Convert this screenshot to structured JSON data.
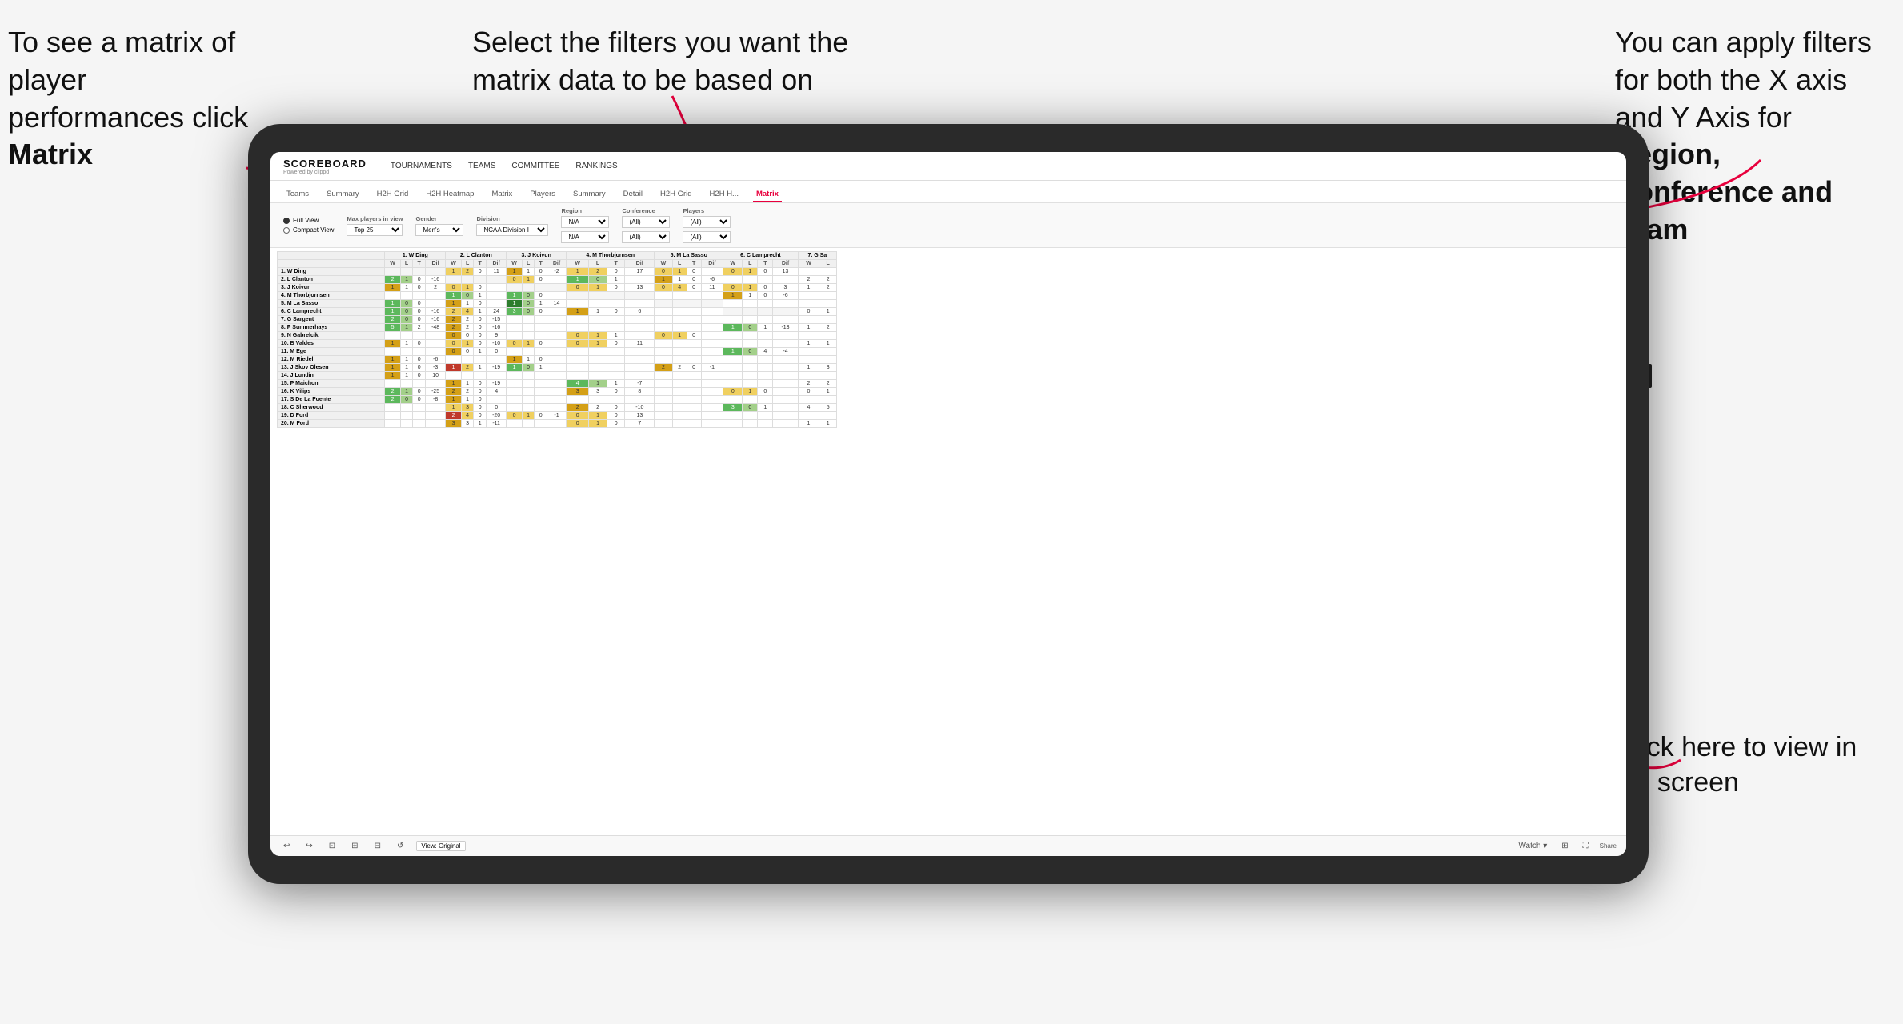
{
  "annotations": {
    "top_left": "To see a matrix of player performances click Matrix",
    "top_left_bold": "Matrix",
    "top_center": "Select the filters you want the matrix data to be based on",
    "top_right_prefix": "You  can apply filters for both the X axis and Y Axis for ",
    "top_right_bold": "Region, Conference and Team",
    "bottom_right": "Click here to view in full screen"
  },
  "scoreboard": {
    "logo": "SCOREBOARD",
    "logo_sub": "Powered by clippd",
    "nav": [
      "TOURNAMENTS",
      "TEAMS",
      "COMMITTEE",
      "RANKINGS"
    ]
  },
  "sub_nav": [
    "Teams",
    "Summary",
    "H2H Grid",
    "H2H Heatmap",
    "Matrix",
    "Players",
    "Summary",
    "Detail",
    "H2H Grid",
    "H2H H...",
    "Matrix"
  ],
  "filters": {
    "views": [
      "Full View",
      "Compact View"
    ],
    "max_players": "Top 25",
    "gender": "Men's",
    "division": "NCAA Division I",
    "region_label": "Region",
    "region_val": "N/A",
    "conference_label": "Conference",
    "conference_val": "(All)",
    "players_label": "Players",
    "players_val": "(All)"
  },
  "matrix": {
    "col_headers": [
      "1. W Ding",
      "2. L Clanton",
      "3. J Koivun",
      "4. M Thorbjornsen",
      "5. M La Sasso",
      "6. C Lamprecht",
      "7. G Sa"
    ],
    "sub_cols": [
      "W",
      "L",
      "T",
      "Dif"
    ],
    "rows": [
      {
        "name": "1. W Ding",
        "cells": [
          [
            null,
            null,
            null,
            null
          ],
          [
            1,
            2,
            0,
            11
          ],
          [
            1,
            1,
            0,
            -2
          ],
          [
            1,
            2,
            0,
            17
          ],
          [
            0,
            1,
            0,
            null
          ],
          [
            0,
            1,
            0,
            13
          ],
          [
            null,
            null
          ]
        ]
      },
      {
        "name": "2. L Clanton",
        "cells": [
          [
            2,
            1,
            0,
            -16
          ],
          [
            null,
            null,
            null,
            null
          ],
          [
            0,
            1,
            0,
            null
          ],
          [
            1,
            0,
            1,
            null
          ],
          [
            1,
            1,
            0,
            -6
          ],
          [
            null,
            null,
            null,
            null
          ],
          [
            2,
            2
          ]
        ]
      },
      {
        "name": "3. J Koivun",
        "cells": [
          [
            1,
            1,
            0,
            2
          ],
          [
            0,
            1,
            0,
            null
          ],
          [
            null,
            null,
            null,
            null
          ],
          [
            0,
            1,
            0,
            13
          ],
          [
            0,
            4,
            0,
            11
          ],
          [
            0,
            1,
            0,
            3
          ],
          [
            1,
            2
          ]
        ]
      },
      {
        "name": "4. M Thorbjornsen",
        "cells": [
          [
            null,
            null,
            null,
            null
          ],
          [
            1,
            0,
            1,
            null
          ],
          [
            1,
            0,
            0,
            null
          ],
          [
            null,
            null,
            null,
            null
          ],
          [
            null,
            null,
            null,
            null
          ],
          [
            1,
            1,
            0,
            -6
          ],
          [
            null,
            null
          ]
        ]
      },
      {
        "name": "5. M La Sasso",
        "cells": [
          [
            1,
            0,
            0,
            null
          ],
          [
            1,
            1,
            0,
            null
          ],
          [
            1,
            0,
            1,
            14
          ],
          [
            null,
            null,
            null,
            null
          ],
          [
            null,
            null,
            null,
            null
          ],
          [
            null,
            null,
            null,
            null
          ],
          [
            null,
            null
          ]
        ]
      },
      {
        "name": "6. C Lamprecht",
        "cells": [
          [
            1,
            0,
            0,
            -16
          ],
          [
            2,
            4,
            1,
            24
          ],
          [
            3,
            0,
            0,
            null
          ],
          [
            1,
            1,
            0,
            6
          ],
          [
            null,
            null,
            null,
            null
          ],
          [
            null,
            null,
            null,
            null
          ],
          [
            0,
            1
          ]
        ]
      },
      {
        "name": "7. G Sargent",
        "cells": [
          [
            2,
            0,
            0,
            -16
          ],
          [
            2,
            2,
            0,
            -15
          ],
          [
            null,
            null,
            null,
            null
          ],
          [
            null,
            null,
            null,
            null
          ],
          [
            null,
            null,
            null,
            null
          ],
          [
            null,
            null,
            null,
            null
          ],
          [
            null,
            null
          ]
        ]
      },
      {
        "name": "8. P Summerhays",
        "cells": [
          [
            5,
            1,
            2,
            -48
          ],
          [
            2,
            2,
            0,
            -16
          ],
          [
            null,
            null,
            null,
            null
          ],
          [
            null,
            null,
            null,
            null
          ],
          [
            null,
            null,
            null,
            null
          ],
          [
            1,
            0,
            1,
            -13
          ],
          [
            1,
            2
          ]
        ]
      },
      {
        "name": "9. N Gabrelcik",
        "cells": [
          [
            null,
            null,
            null,
            null
          ],
          [
            0,
            0,
            0,
            9
          ],
          [
            null,
            null,
            null,
            null
          ],
          [
            0,
            1,
            1,
            null
          ],
          [
            0,
            1,
            0,
            null
          ],
          [
            null,
            null,
            null,
            null
          ],
          [
            null,
            null
          ]
        ]
      },
      {
        "name": "10. B Valdes",
        "cells": [
          [
            1,
            1,
            0,
            null
          ],
          [
            0,
            1,
            0,
            -10
          ],
          [
            0,
            1,
            0,
            null
          ],
          [
            0,
            1,
            0,
            11
          ],
          [
            null,
            null,
            null,
            null
          ],
          [
            null,
            null,
            null,
            null
          ],
          [
            1,
            1
          ]
        ]
      },
      {
        "name": "11. M Ege",
        "cells": [
          [
            null,
            null,
            null,
            null
          ],
          [
            0,
            0,
            1,
            0
          ],
          [
            null,
            null,
            null,
            null
          ],
          [
            null,
            null,
            null,
            null
          ],
          [
            null,
            null,
            null,
            null
          ],
          [
            1,
            0,
            4,
            -4
          ],
          [
            null,
            null
          ]
        ]
      },
      {
        "name": "12. M Riedel",
        "cells": [
          [
            1,
            1,
            0,
            -6
          ],
          [
            null,
            null,
            null,
            null
          ],
          [
            1,
            1,
            0,
            null
          ],
          [
            null,
            null,
            null,
            null
          ],
          [
            null,
            null,
            null,
            null
          ],
          [
            null,
            null,
            null,
            null
          ],
          [
            null,
            null
          ]
        ]
      },
      {
        "name": "13. J Skov Olesen",
        "cells": [
          [
            1,
            1,
            0,
            -3
          ],
          [
            1,
            2,
            1,
            -19
          ],
          [
            1,
            0,
            1,
            null
          ],
          [
            null,
            null,
            null,
            null
          ],
          [
            2,
            2,
            0,
            -1
          ],
          [
            null,
            null,
            null,
            null
          ],
          [
            1,
            3
          ]
        ]
      },
      {
        "name": "14. J Lundin",
        "cells": [
          [
            1,
            1,
            0,
            10
          ],
          [
            null,
            null,
            null,
            null
          ],
          [
            null,
            null,
            null,
            null
          ],
          [
            null,
            null,
            null,
            null
          ],
          [
            null,
            null,
            null,
            null
          ],
          [
            null,
            null,
            null,
            null
          ],
          [
            null,
            null
          ]
        ]
      },
      {
        "name": "15. P Maichon",
        "cells": [
          [
            null,
            null,
            null,
            null
          ],
          [
            1,
            1,
            0,
            -19
          ],
          [
            null,
            null,
            null,
            null
          ],
          [
            4,
            1,
            1,
            -7
          ],
          [
            null,
            null,
            null,
            null
          ],
          [
            null,
            null,
            null,
            null
          ],
          [
            2,
            2
          ]
        ]
      },
      {
        "name": "16. K Vilips",
        "cells": [
          [
            2,
            1,
            0,
            -25
          ],
          [
            2,
            2,
            0,
            4
          ],
          [
            null,
            null,
            null,
            null
          ],
          [
            3,
            3,
            0,
            8
          ],
          [
            null,
            null,
            null,
            null
          ],
          [
            0,
            1,
            0,
            null
          ],
          [
            0,
            1
          ]
        ]
      },
      {
        "name": "17. S De La Fuente",
        "cells": [
          [
            2,
            0,
            0,
            -8
          ],
          [
            1,
            1,
            0,
            null
          ],
          [
            null,
            null,
            null,
            null
          ],
          [
            null,
            null,
            null,
            null
          ],
          [
            null,
            null,
            null,
            null
          ],
          [
            null,
            null,
            null,
            null
          ],
          [
            null,
            null
          ]
        ]
      },
      {
        "name": "18. C Sherwood",
        "cells": [
          [
            null,
            null,
            null,
            null
          ],
          [
            1,
            3,
            0,
            0
          ],
          [
            null,
            null,
            null,
            null
          ],
          [
            2,
            2,
            0,
            -10
          ],
          [
            null,
            null,
            null,
            null
          ],
          [
            3,
            0,
            1,
            null
          ],
          [
            4,
            5
          ]
        ]
      },
      {
        "name": "19. D Ford",
        "cells": [
          [
            null,
            null,
            null,
            null
          ],
          [
            2,
            4,
            0,
            -20
          ],
          [
            0,
            1,
            0,
            -1
          ],
          [
            0,
            1,
            0,
            13
          ],
          [
            null,
            null,
            null,
            null
          ],
          [
            null,
            null,
            null,
            null
          ],
          [
            null,
            null
          ]
        ]
      },
      {
        "name": "20. M Ford",
        "cells": [
          [
            null,
            null,
            null,
            null
          ],
          [
            3,
            3,
            1,
            -11
          ],
          [
            null,
            null,
            null,
            null
          ],
          [
            0,
            1,
            0,
            7
          ],
          [
            null,
            null,
            null,
            null
          ],
          [
            null,
            null,
            null,
            null
          ],
          [
            1,
            1
          ]
        ]
      }
    ]
  },
  "toolbar": {
    "undo": "↩",
    "redo": "↪",
    "view_original": "View: Original",
    "watch": "Watch ▾",
    "share": "Share"
  }
}
